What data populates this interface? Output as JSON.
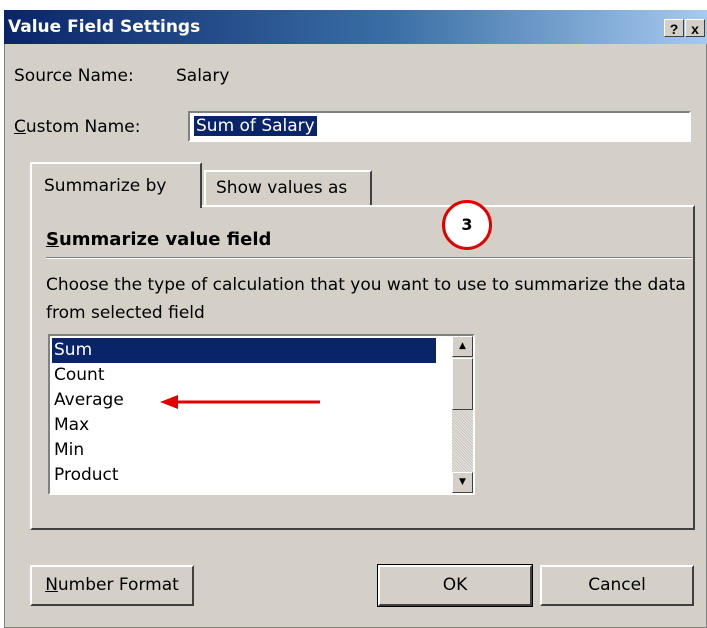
{
  "window": {
    "title": "Value Field Settings",
    "help_button": "?",
    "close_button": "x"
  },
  "source": {
    "label": "Source Name:",
    "value": "Salary"
  },
  "custom_name": {
    "label_accel": "C",
    "label_rest": "ustom Name:",
    "value": "Sum of Salary"
  },
  "tabs": [
    {
      "label": "Summarize by",
      "active": true
    },
    {
      "label": "Show values as",
      "active": false
    }
  ],
  "panel": {
    "title_accel": "S",
    "title_rest": "ummarize value field",
    "description": "Choose the type of calculation that you want to use to summarize the data from selected field",
    "list_items": [
      "Sum",
      "Count",
      "Average",
      "Max",
      "Min",
      "Product"
    ],
    "selected_item": "Sum"
  },
  "buttons": {
    "number_format_accel": "N",
    "number_format_rest": "umber Format",
    "ok": "OK",
    "cancel": "Cancel"
  },
  "annotations": {
    "step_number": "3",
    "arrow_target": "Average",
    "color": "#e00000"
  },
  "colors": {
    "title_bar": "#0a246a",
    "dialog_face": "#d4d0c8",
    "selection": "#0a246a"
  }
}
